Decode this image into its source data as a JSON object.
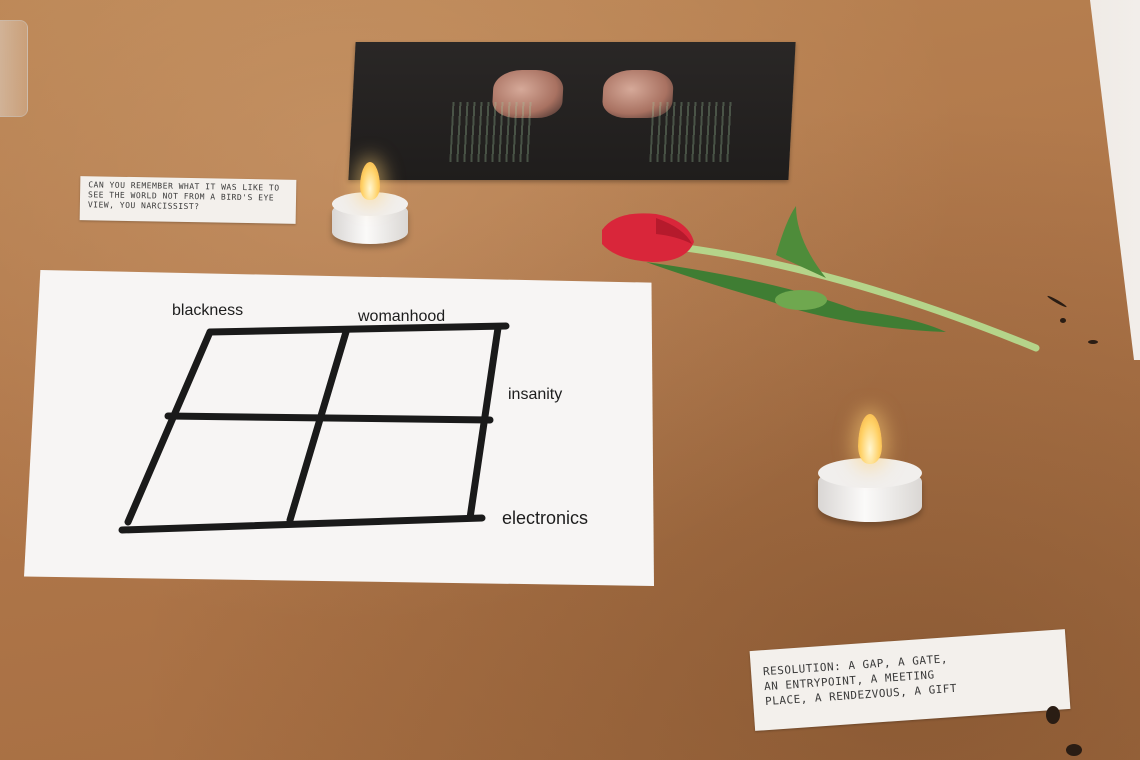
{
  "grid_labels": {
    "top_left": "blackness",
    "top_right": "womanhood",
    "right_middle": "insanity",
    "bottom_right": "electronics"
  },
  "notes": {
    "small_note": "CAN YOU REMEMBER WHAT IT WAS LIKE TO SEE THE WORLD NOT FROM A BIRD'S EYE VIEW, YOU NARCISSIST?",
    "large_note_line1": "RESOLUTION: A GAP, A GATE,",
    "large_note_line2": "AN ENTRYPOINT, A MEETING",
    "large_note_line3": "PLACE, A RENDEZVOUS, A GIFT"
  },
  "colors": {
    "table": "#b0774a",
    "paper": "#f7f5f4",
    "ink": "#1a1a1a",
    "tulip_red": "#d9263a",
    "stem_green": "#b5d48a",
    "flame": "#ffd166"
  },
  "icons": {
    "candle": "tealight-candle-icon",
    "flower": "tulip-icon"
  }
}
